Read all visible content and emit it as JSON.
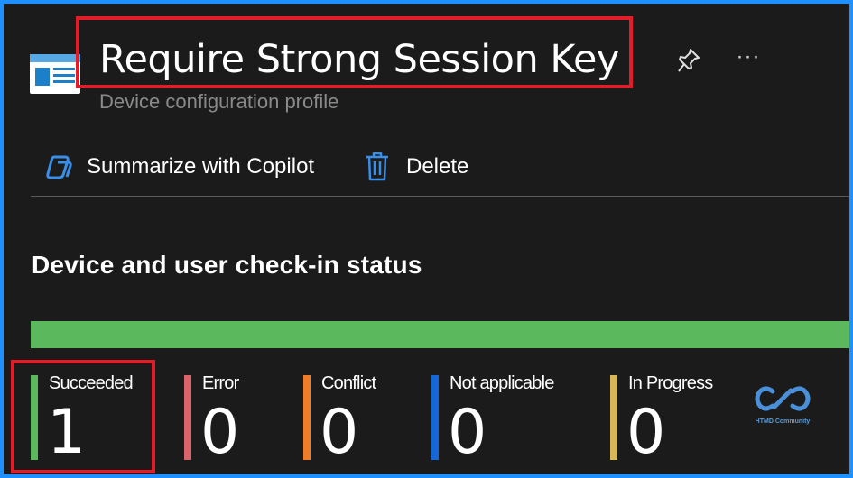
{
  "header": {
    "title": "Require Strong Session Key",
    "subtitle": "Device configuration profile",
    "icon": "device-config-profile-icon"
  },
  "toolbar": {
    "copilot_label": "Summarize with Copilot",
    "delete_label": "Delete"
  },
  "section": {
    "title": "Device and user check-in status"
  },
  "progress": {
    "succeeded_fraction": 1.0
  },
  "stats": [
    {
      "label": "Succeeded",
      "value": "1",
      "color": "#5cb85c"
    },
    {
      "label": "Error",
      "value": "0",
      "color": "#d9646c"
    },
    {
      "label": "Conflict",
      "value": "0",
      "color": "#f07c2a"
    },
    {
      "label": "Not applicable",
      "value": "0",
      "color": "#1668d8"
    },
    {
      "label": "In Progress",
      "value": "0",
      "color": "#d6b656"
    }
  ],
  "watermark": {
    "text": "HTMD Community"
  },
  "colors": {
    "accent_border": "#1e90ff",
    "highlight": "#e11d2a",
    "background": "#1b1b1b"
  }
}
